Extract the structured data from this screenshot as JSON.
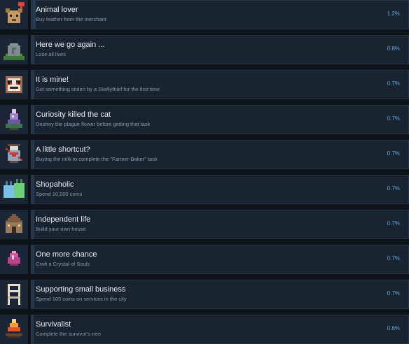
{
  "achievements": [
    {
      "icon": "pet-heart-icon",
      "title": "Animal lover",
      "description": "Buy leather from the merchant",
      "percent": "1.2%",
      "value": 1.2
    },
    {
      "icon": "gravestone-icon",
      "title": "Here we go again ...",
      "description": "Lose all lives",
      "percent": "0.8%",
      "value": 0.8
    },
    {
      "icon": "thief-face-icon",
      "title": "It is mine!",
      "description": "Get something stolen by a Skellythief for the first time",
      "percent": "0.7%",
      "value": 0.7
    },
    {
      "icon": "plague-flower-icon",
      "title": "Curiosity killed the cat",
      "description": "Destroy the plague flower before getting that task",
      "percent": "0.7%",
      "value": 0.7
    },
    {
      "icon": "milk-shortcut-icon",
      "title": "A little shortcut?",
      "description": "Buying the milk to complete the \"Farmer-Baker\" task",
      "percent": "0.7%",
      "value": 0.7
    },
    {
      "icon": "shopping-bags-icon",
      "title": "Shopaholic",
      "description": "Spend 10,000 coins",
      "percent": "0.7%",
      "value": 0.7
    },
    {
      "icon": "house-icon",
      "title": "Independent life",
      "description": "Build your own house",
      "percent": "0.7%",
      "value": 0.7
    },
    {
      "icon": "crystal-of-souls-icon",
      "title": "One more chance",
      "description": "Craft a Crystal of Souls",
      "percent": "0.7%",
      "value": 0.7
    },
    {
      "icon": "chair-icon",
      "title": "Supporting small business",
      "description": "Spend 100 coins on services in the city",
      "percent": "0.7%",
      "value": 0.7
    },
    {
      "icon": "campfire-tree-icon",
      "title": "Survivalist",
      "description": "Complete the survivor's tree",
      "percent": "0.6%",
      "value": 0.6
    }
  ]
}
